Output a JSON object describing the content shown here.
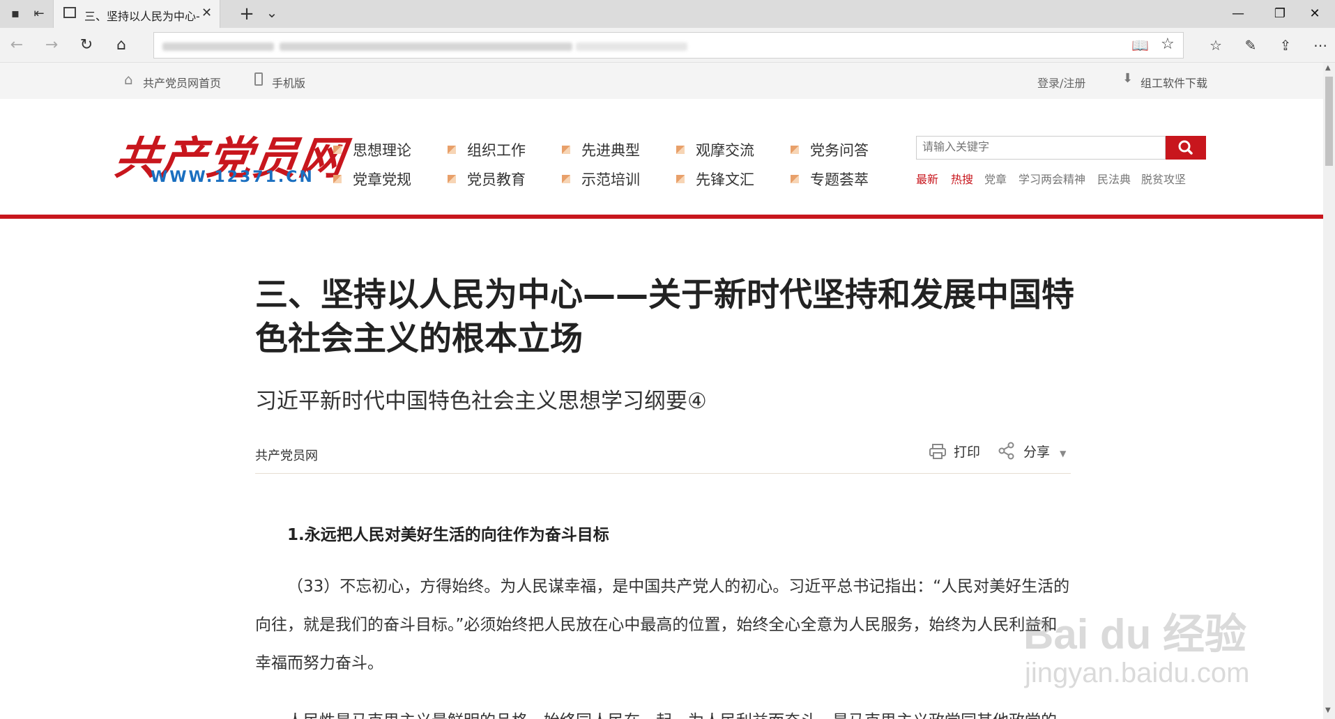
{
  "browser": {
    "tab_title": "三、坚持以人民为中心-",
    "new_tab": "+",
    "tab_menu": "⌄",
    "minimize": "—",
    "maximize": "❐",
    "close": "✕"
  },
  "topbar": {
    "home_link": "共产党员网首页",
    "mobile_link": "手机版",
    "login": "登录/注册",
    "download": "组工软件下载"
  },
  "logo": {
    "name": "共产党员网",
    "url": "WWW.12371.CN"
  },
  "nav": {
    "row1": [
      "思想理论",
      "组织工作",
      "先进典型",
      "观摩交流",
      "党务问答"
    ],
    "row2": [
      "党章党规",
      "党员教育",
      "示范培训",
      "先锋文汇",
      "专题荟萃"
    ]
  },
  "search": {
    "placeholder": "请输入关键字",
    "hot": [
      "最新",
      "热搜",
      "党章",
      "学习两会精神",
      "民法典",
      "脱贫攻坚"
    ]
  },
  "article": {
    "title": "三、坚持以人民为中心——关于新时代坚持和发展中国特色社会主义的根本立场",
    "subtitle": "习近平新时代中国特色社会主义思想学习纲要④",
    "source": "共产党员网",
    "print": "打印",
    "share": "分享",
    "heading": "1.永远把人民对美好生活的向往作为奋斗目标",
    "para1": "（33）不忘初心，方得始终。为人民谋幸福，是中国共产党人的初心。习近平总书记指出：“人民对美好生活的向往，就是我们的奋斗目标。”必须始终把人民放在心中最高的位置，始终全心全意为人民服务，始终为人民利益和幸福而努力奋斗。",
    "para2": "人民性是马克思主义最鲜明的品格。始终同人民在一起，为人民利益而奋斗，是马克思主义政党同其他政党的"
  },
  "watermark": {
    "brand": "Bai du 经验",
    "url": "jingyan.baidu.com"
  },
  "colors": {
    "brand_red": "#c8161d",
    "logo_blue": "#1a6fc0"
  }
}
